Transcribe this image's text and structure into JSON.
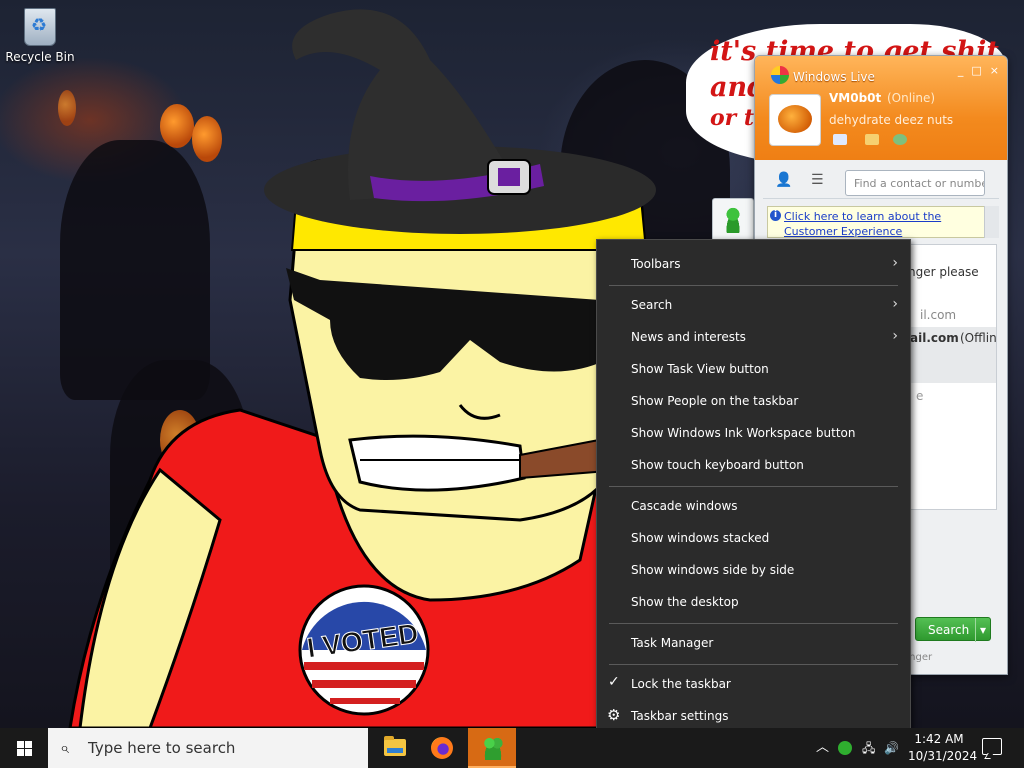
{
  "desktop": {
    "icons": [
      {
        "label": "Recycle Bin",
        "icon": "recycle-bin-icon"
      }
    ],
    "wallpaper_bubble_text": [
      "it's time to get shit",
      "and",
      "or t"
    ],
    "sticker_text": "I VOTED"
  },
  "messenger": {
    "title": "Windows Live",
    "window_buttons": [
      "_",
      "□",
      "×"
    ],
    "user_name": "VM0b0t",
    "status": "(Online)",
    "personal_message": "dehydrate deez nuts",
    "find_placeholder": "Find a contact or number",
    "info_link_line1": "Click here to learn about the",
    "info_link_line2": "Customer Experience",
    "contact_fragment_1": "nger please",
    "contact_fragment_2": "il.com",
    "contact_fragment_3": "ail.com",
    "contact_offline": "(Offlin",
    "contact_fragment_4": "e",
    "search_button": "Search",
    "footer_fragment": "enger",
    "accent": "#f38a1e"
  },
  "context_menu": {
    "items": [
      {
        "label": "Toolbars",
        "submenu": true
      },
      {
        "label": "Search",
        "submenu": true
      },
      {
        "label": "News and interests",
        "submenu": true
      },
      {
        "label": "Show Task View button"
      },
      {
        "label": "Show People on the taskbar"
      },
      {
        "label": "Show Windows Ink Workspace button"
      },
      {
        "label": "Show touch keyboard button"
      },
      {
        "label": "Cascade windows"
      },
      {
        "label": "Show windows stacked"
      },
      {
        "label": "Show windows side by side"
      },
      {
        "label": "Show the desktop"
      },
      {
        "label": "Task Manager"
      },
      {
        "label": "Lock the taskbar",
        "checked": true
      },
      {
        "label": "Taskbar settings",
        "icon": "gear-icon"
      }
    ],
    "arrow_glyph": "›",
    "check_glyph": "✓",
    "gear_glyph": "⚙",
    "background": "#2b2b2b"
  },
  "taskbar": {
    "search_placeholder": "Type here to search",
    "apps": [
      "file-explorer-icon",
      "firefox-icon",
      "messenger-icon"
    ],
    "time": "1:42 AM",
    "date": "10/31/2024",
    "tray_up_glyph": "︿",
    "volume_glyph": "🔊",
    "network_glyph": "🖧"
  }
}
